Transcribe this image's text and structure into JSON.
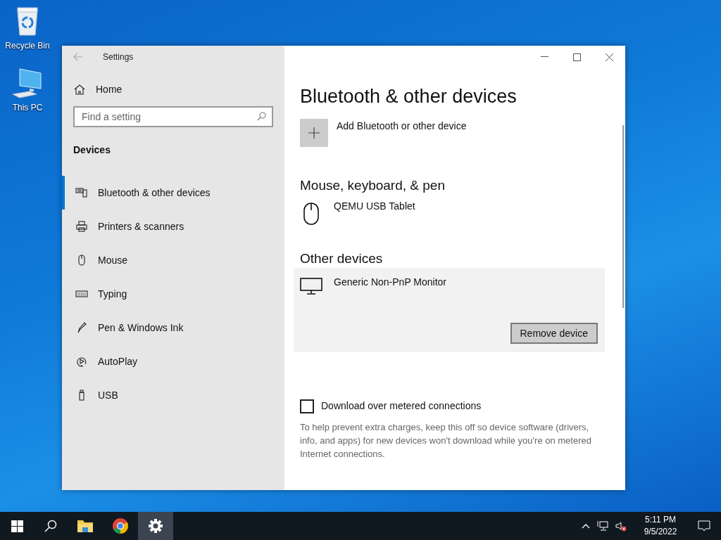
{
  "desktop_icons": [
    {
      "label": "Recycle Bin",
      "kind": "recycle"
    },
    {
      "label": "This PC",
      "kind": "pc"
    }
  ],
  "window": {
    "title": "Settings"
  },
  "sidebar": {
    "home": "Home",
    "search_placeholder": "Find a setting",
    "section": "Devices",
    "items": [
      {
        "label": "Bluetooth & other devices",
        "kind": "bluetooth",
        "selected": true
      },
      {
        "label": "Printers & scanners",
        "kind": "printer",
        "selected": false
      },
      {
        "label": "Mouse",
        "kind": "mouse",
        "selected": false
      },
      {
        "label": "Typing",
        "kind": "keyboard",
        "selected": false
      },
      {
        "label": "Pen & Windows Ink",
        "kind": "pen",
        "selected": false
      },
      {
        "label": "AutoPlay",
        "kind": "autoplay",
        "selected": false
      },
      {
        "label": "USB",
        "kind": "usb",
        "selected": false
      }
    ]
  },
  "content": {
    "title": "Bluetooth & other devices",
    "add_device": "Add Bluetooth or other device",
    "groups": [
      {
        "heading": "Mouse, keyboard, & pen",
        "devices": [
          {
            "name": "QEMU USB Tablet",
            "kind": "mouse",
            "selected": false
          }
        ]
      },
      {
        "heading": "Other devices",
        "devices": [
          {
            "name": "Generic Non-PnP Monitor",
            "kind": "monitor",
            "selected": true,
            "action": "Remove device"
          }
        ]
      }
    ],
    "metered": {
      "label": "Download over metered connections",
      "checked": false,
      "description": "To help prevent extra charges, keep this off so device software (drivers, info, and apps) for new devices won't download while you're on metered Internet connections."
    }
  },
  "taskbar": {
    "apps": [
      {
        "kind": "explorer",
        "active": false
      },
      {
        "kind": "chrome",
        "active": false
      },
      {
        "kind": "settings",
        "active": true
      }
    ],
    "clock": {
      "time": "5:11 PM",
      "date": "9/5/2022"
    }
  }
}
